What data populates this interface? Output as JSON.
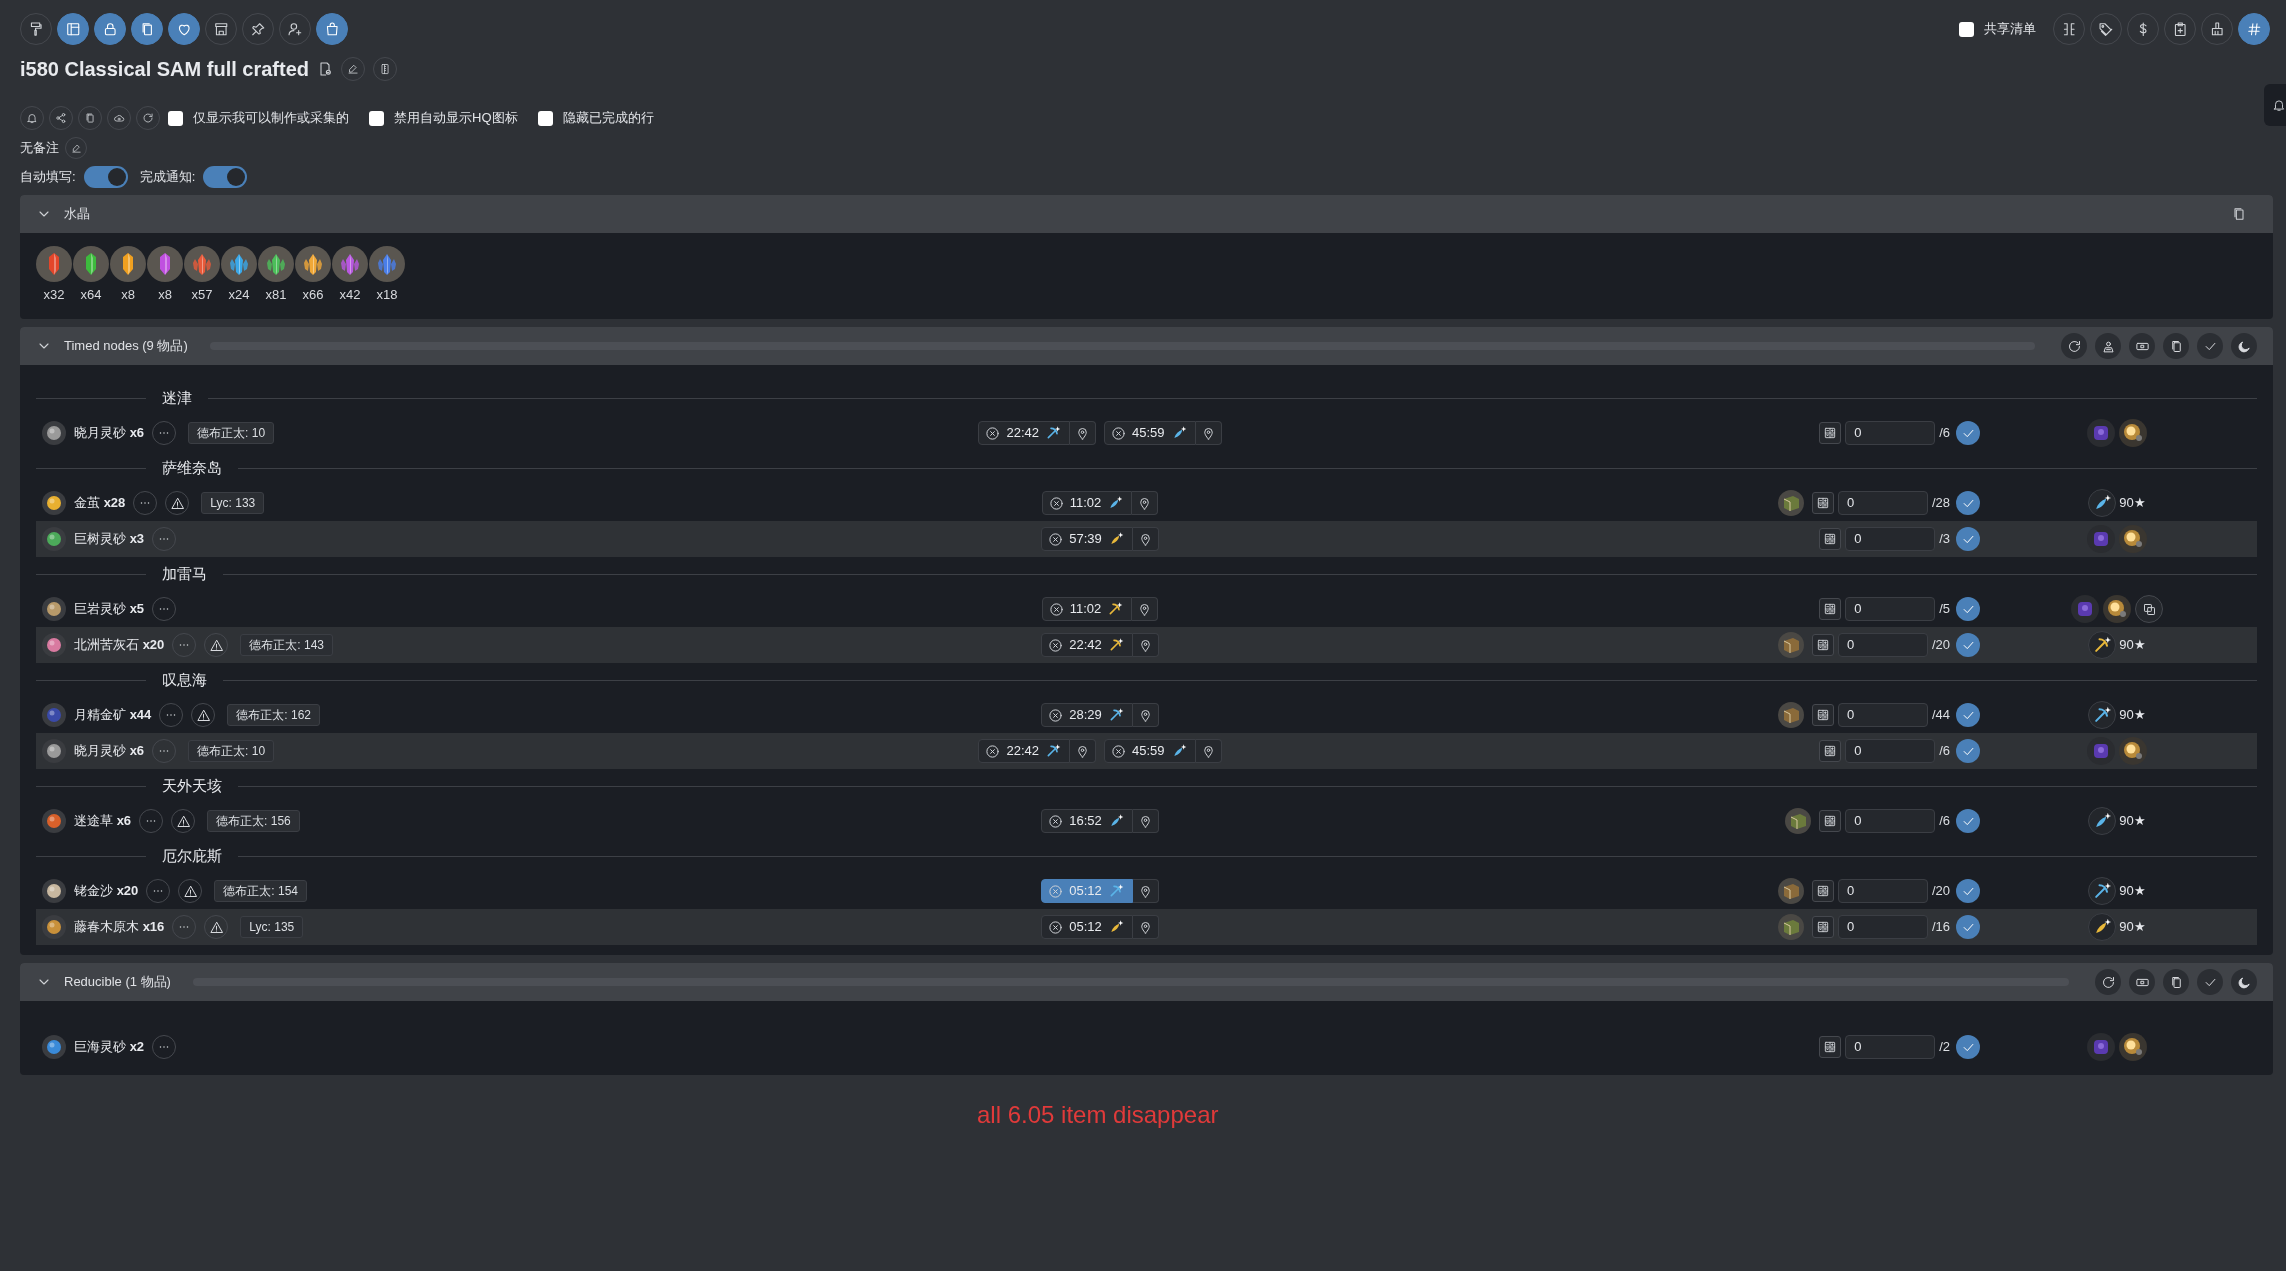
{
  "toolbar": {
    "left": [
      {
        "kind": "roller",
        "selected": false
      },
      {
        "kind": "layout",
        "selected": true
      },
      {
        "kind": "lock",
        "selected": true
      },
      {
        "kind": "copy",
        "selected": true
      },
      {
        "kind": "heart",
        "selected": true
      },
      {
        "kind": "store",
        "selected": false
      },
      {
        "kind": "pin",
        "selected": false
      },
      {
        "kind": "user-plus",
        "selected": false
      },
      {
        "kind": "bag",
        "selected": true
      }
    ],
    "share": {
      "label": "共享清单",
      "checked": false
    },
    "right": [
      {
        "kind": "columns",
        "selected": false
      },
      {
        "kind": "tags",
        "selected": false
      },
      {
        "kind": "dollar",
        "selected": false
      },
      {
        "kind": "clipboard",
        "selected": false
      },
      {
        "kind": "broom",
        "selected": false
      },
      {
        "kind": "hash",
        "selected": true
      }
    ]
  },
  "title": "i580 Classical SAM full crafted",
  "options": [
    {
      "label": "仅显示我可以制作或采集的",
      "checked": false
    },
    {
      "label": "禁用自动显示HQ图标",
      "checked": false
    },
    {
      "label": "隐藏已完成的行",
      "checked": false
    }
  ],
  "note": "无备注",
  "toggles": [
    {
      "label": "自动填写:",
      "on": true
    },
    {
      "label": "完成通知:",
      "on": true
    }
  ],
  "crystals": {
    "title": "水晶",
    "expanded": true,
    "items": [
      {
        "kind": "shard",
        "color": "#e3462a",
        "count": "x32"
      },
      {
        "kind": "shard",
        "color": "#3dbb3d",
        "count": "x64"
      },
      {
        "kind": "shard",
        "color": "#f0a020",
        "count": "x8"
      },
      {
        "kind": "shard",
        "color": "#c050e0",
        "count": "x8"
      },
      {
        "kind": "cluster",
        "color": "#e85a3a",
        "count": "x57"
      },
      {
        "kind": "cluster",
        "color": "#3aa8e8",
        "count": "x24"
      },
      {
        "kind": "cluster",
        "color": "#4cbf5a",
        "count": "x81"
      },
      {
        "kind": "cluster",
        "color": "#f0a838",
        "count": "x66"
      },
      {
        "kind": "cluster",
        "color": "#b858e0",
        "count": "x42"
      },
      {
        "kind": "cluster",
        "color": "#4a7ee8",
        "count": "x18"
      }
    ]
  },
  "panels": [
    {
      "title": "Timed nodes (9 物品)",
      "expanded": true,
      "tools": [
        {
          "kind": "refresh"
        },
        {
          "kind": "person-map"
        },
        {
          "kind": "ticket"
        },
        {
          "kind": "copy"
        },
        {
          "kind": "check"
        },
        {
          "kind": "moon"
        }
      ],
      "groups": [
        {
          "name": "迷津",
          "rows": [
            {
              "name": "晓月灵砂 **x6**",
              "color": "#9a9a9a",
              "warning": false,
              "tag": "德布正太: 10",
              "timers": [
                {
                  "time": "22:42",
                  "kind": "pick",
                  "color": "#5ab4e8",
                  "selected": false
                },
                {
                  "time": "45:59",
                  "kind": "quill",
                  "color": "#5ab4e8",
                  "selected": false
                }
              ],
              "done": "0",
              "total": "/6",
              "reward": {
                "kind": "reduce",
                "copy": false
              }
            }
          ]
        },
        {
          "name": "萨维奈岛",
          "rows": [
            {
              "name": "金茧 **x28**",
              "color": "#e8b030",
              "warning": true,
              "tag": "Lyc: 133",
              "timers": [
                {
                  "time": "11:02",
                  "kind": "quill",
                  "color": "#5ab4e8",
                  "selected": false
                }
              ],
              "book": {
                "color": "#6b7a3c"
              },
              "done": "0",
              "total": "/28",
              "reward": {
                "kind": "gather",
                "badge": {
                  "kind": "quill",
                  "color": "#5ab4e8"
                },
                "label": "90★"
              }
            },
            {
              "name": "巨树灵砂 **x3**",
              "color": "#4caa5a",
              "warning": false,
              "timers": [
                {
                  "time": "57:39",
                  "kind": "quill",
                  "color": "#e8b83a",
                  "selected": false
                }
              ],
              "done": "0",
              "total": "/3",
              "reward": {
                "kind": "reduce",
                "copy": false
              }
            }
          ]
        },
        {
          "name": "加雷马",
          "rows": [
            {
              "name": "巨岩灵砂 **x5**",
              "color": "#b89a6a",
              "warning": false,
              "timers": [
                {
                  "time": "11:02",
                  "kind": "pick",
                  "color": "#e8b83a",
                  "selected": false
                }
              ],
              "done": "0",
              "total": "/5",
              "reward": {
                "kind": "reduce",
                "copy": true
              }
            },
            {
              "name": "北洲苦灰石 **x20**",
              "color": "#d87aa0",
              "warning": true,
              "tag": "德布正太: 143",
              "timers": [
                {
                  "time": "22:42",
                  "kind": "pick",
                  "color": "#e8b83a",
                  "selected": false
                }
              ],
              "book": {
                "color": "#8a6a3a"
              },
              "done": "0",
              "total": "/20",
              "reward": {
                "kind": "gather",
                "badge": {
                  "kind": "pick",
                  "color": "#e8b83a"
                },
                "label": "90★"
              }
            }
          ]
        },
        {
          "name": "叹息海",
          "rows": [
            {
              "name": "月精金矿 **x44**",
              "color": "#3a4aa8",
              "warning": true,
              "tag": "德布正太: 162",
              "timers": [
                {
                  "time": "28:29",
                  "kind": "pick",
                  "color": "#5ab4e8",
                  "selected": false
                }
              ],
              "book": {
                "color": "#8a6a3a"
              },
              "done": "0",
              "total": "/44",
              "reward": {
                "kind": "gather",
                "badge": {
                  "kind": "pick",
                  "color": "#5ab4e8"
                },
                "label": "90★"
              }
            },
            {
              "name": "晓月灵砂 **x6**",
              "color": "#9a9a9a",
              "warning": false,
              "tag": "德布正太: 10",
              "timers": [
                {
                  "time": "22:42",
                  "kind": "pick",
                  "color": "#5ab4e8",
                  "selected": false
                },
                {
                  "time": "45:59",
                  "kind": "quill",
                  "color": "#5ab4e8",
                  "selected": false
                }
              ],
              "done": "0",
              "total": "/6",
              "reward": {
                "kind": "reduce",
                "copy": false
              }
            }
          ]
        },
        {
          "name": "天外天垓",
          "rows": [
            {
              "name": "迷途草 **x6**",
              "color": "#d8602a",
              "warning": true,
              "tag": "德布正太: 156",
              "timers": [
                {
                  "time": "16:52",
                  "kind": "quill",
                  "color": "#5ab4e8",
                  "selected": false
                }
              ],
              "book": {
                "color": "#6b7a3c"
              },
              "done": "0",
              "total": "/6",
              "reward": {
                "kind": "gather",
                "badge": {
                  "kind": "quill",
                  "color": "#5ab4e8"
                },
                "label": "90★"
              }
            }
          ]
        },
        {
          "name": "厄尔庇斯",
          "rows": [
            {
              "name": "铑金沙 **x20**",
              "color": "#c8b8a0",
              "warning": true,
              "tag": "德布正太: 154",
              "timers": [
                {
                  "time": "05:12",
                  "kind": "pick",
                  "color": "#5ab4e8",
                  "selected": true
                }
              ],
              "book": {
                "color": "#8a6a3a"
              },
              "done": "0",
              "total": "/20",
              "reward": {
                "kind": "gather",
                "badge": {
                  "kind": "pick",
                  "color": "#5ab4e8"
                },
                "label": "90★"
              }
            },
            {
              "name": "藤春木原木 **x16**",
              "color": "#c8903a",
              "warning": true,
              "tag": "Lyc: 135",
              "timers": [
                {
                  "time": "05:12",
                  "kind": "quill",
                  "color": "#e8b83a",
                  "selected": false
                }
              ],
              "book": {
                "color": "#6b7a3c"
              },
              "done": "0",
              "total": "/16",
              "reward": {
                "kind": "gather",
                "badge": {
                  "kind": "quill",
                  "color": "#e8b83a"
                },
                "label": "90★"
              }
            }
          ]
        }
      ]
    },
    {
      "title": "Reducible (1 物品)",
      "expanded": true,
      "tools": [
        {
          "kind": "refresh"
        },
        {
          "kind": "ticket"
        },
        {
          "kind": "copy"
        },
        {
          "kind": "check"
        },
        {
          "kind": "moon"
        }
      ],
      "groups": [
        {
          "rows": [
            {
              "name": "巨海灵砂 **x2**",
              "color": "#3a8ad8",
              "warning": false,
              "timers": [],
              "done": "0",
              "total": "/2",
              "reward": {
                "kind": "reduce",
                "copy": false
              }
            }
          ]
        }
      ]
    }
  ],
  "annotation": "all 6.05 item disappear"
}
